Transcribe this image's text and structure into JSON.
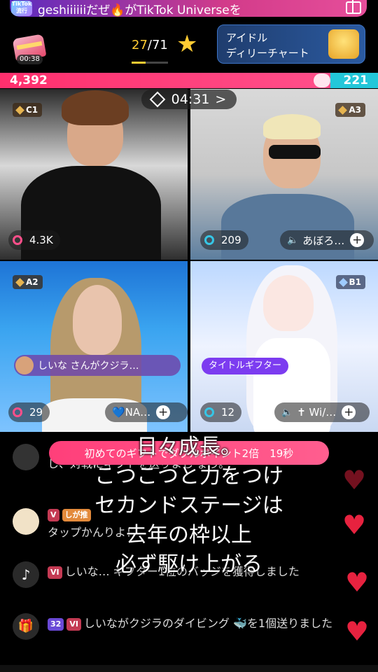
{
  "banner": {
    "badge_text": "TikTok 流行",
    "text": "geshiiiiiiだぜ🔥がTikTok Universeを",
    "gift_icon": "gift-icon"
  },
  "chest": {
    "timer": "00:38"
  },
  "counter": {
    "current": "27",
    "total": "/71",
    "progress": 0.38
  },
  "idol_chart": {
    "line1": "アイドル",
    "line2": "ディリーチャート"
  },
  "battle": {
    "left_score": "4,392",
    "right_score": "221"
  },
  "timer": {
    "value": "04:31",
    "chevron": ">"
  },
  "cells": [
    {
      "rank": "C1",
      "score": "4.3K"
    },
    {
      "rank": "A3",
      "score": "209",
      "name": "あぼろ…"
    },
    {
      "rank": "A2",
      "score": "29",
      "name": "💙NA…",
      "gift_toast": "しいな さんがクジラ…"
    },
    {
      "rank": "B1",
      "score": "12",
      "name": "✝ Wi/…",
      "title_tag": "タイトルギフター"
    }
  ],
  "notice": "初めてのギフトでダブルポイント2倍　19秒",
  "chat": [
    {
      "text": "し、対戦にギフトを送りまし ょう。",
      "badges": []
    },
    {
      "text": "タップかんりよ！",
      "badges": [
        "V",
        "しが推"
      ]
    },
    {
      "text": "しいな… ギフター1位のバッジを獲得しました",
      "badges": [
        "VI"
      ]
    },
    {
      "text": "しいながクジラのダイビング 🐳を1個送りました",
      "badges": [
        "32",
        "VI"
      ]
    }
  ],
  "caption": {
    "line1": "日々成長。",
    "line2": "こつこつと力をつけ",
    "line3": "セカンドステージは",
    "line4": "去年の枠以上",
    "line5": "必ず駆け上がる"
  },
  "colors": {
    "accent_pink": "#ff3f7a",
    "accent_blue": "#23c7d9",
    "gold": "#ffcc33"
  }
}
